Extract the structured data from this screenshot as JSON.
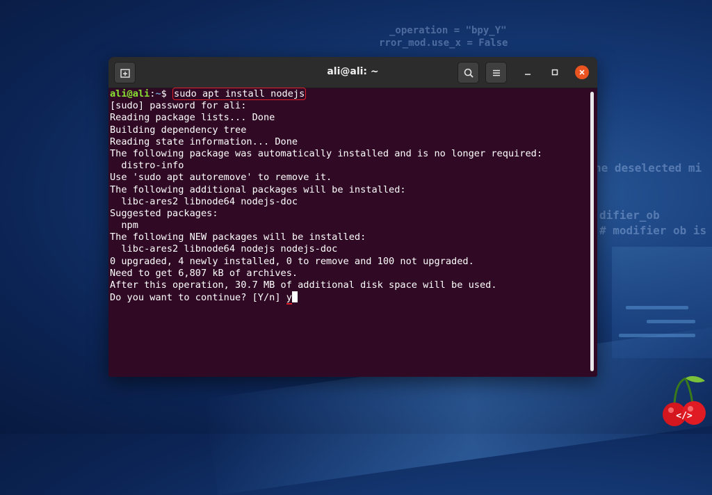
{
  "background": {
    "code_fragments": [
      "_operation = \"bpy_Y\"",
      "rror_mod.use_x = False",
      "he deselected mi",
      "difier_ob",
      "# modifier ob is"
    ]
  },
  "window": {
    "title": "ali@ali: ~",
    "buttons": {
      "new_tab_icon": "new-tab-icon",
      "search_icon": "search-icon",
      "menu_icon": "hamburger-menu-icon",
      "minimize_icon": "minimize-icon",
      "maximize_icon": "maximize-icon",
      "close_icon": "close-icon"
    },
    "colors": {
      "terminal_bg": "#300a24",
      "titlebar_bg": "#2c2c2c",
      "prompt_user": "#8ae234",
      "prompt_path": "#729fcf",
      "close_button": "#e95420",
      "highlight": "#e0202a"
    }
  },
  "terminal": {
    "prompt_user": "ali@ali",
    "prompt_sep": ":",
    "prompt_path": "~",
    "prompt_symbol": "$ ",
    "command": "sudo apt install nodejs",
    "output": [
      "[sudo] password for ali:",
      "Reading package lists... Done",
      "Building dependency tree",
      "Reading state information... Done",
      "The following package was automatically installed and is no longer required:",
      "  distro-info",
      "Use 'sudo apt autoremove' to remove it.",
      "The following additional packages will be installed:",
      "  libc-ares2 libnode64 nodejs-doc",
      "Suggested packages:",
      "  npm",
      "The following NEW packages will be installed:",
      "  libc-ares2 libnode64 nodejs nodejs-doc",
      "0 upgraded, 4 newly installed, 0 to remove and 100 not upgraded.",
      "Need to get 6,807 kB of archives.",
      "After this operation, 30.7 MB of additional disk space will be used."
    ],
    "question": "Do you want to continue? [Y/n] ",
    "answer": "y"
  },
  "logo": {
    "text": "</>",
    "icon": "cherry-logo-icon"
  }
}
